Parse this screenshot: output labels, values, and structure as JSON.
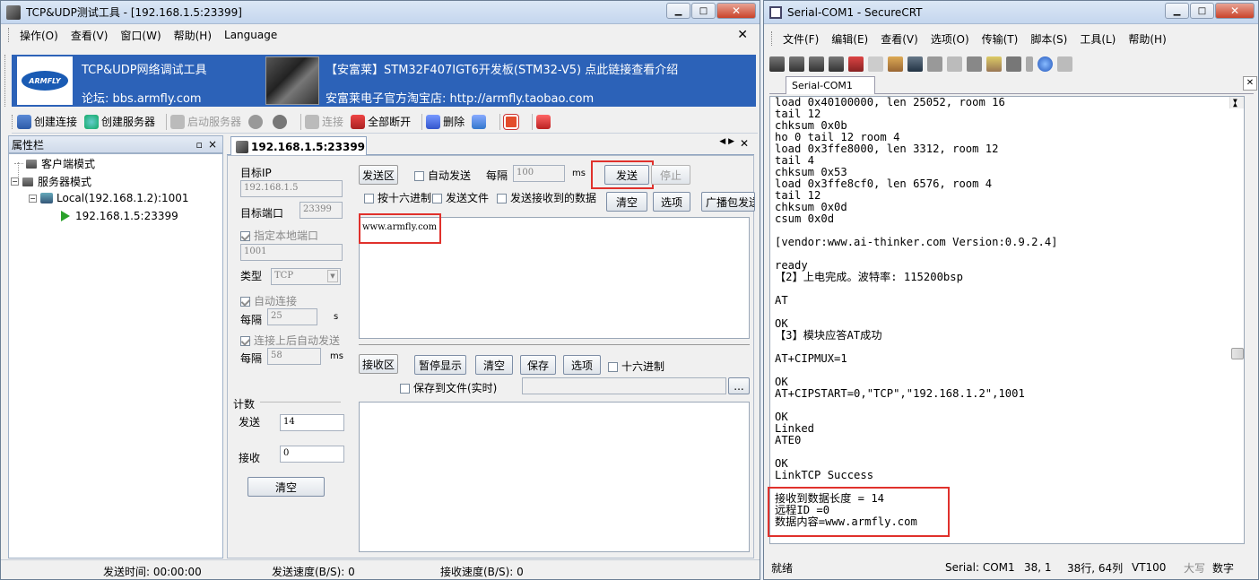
{
  "left_window": {
    "title": "TCP&UDP测试工具 - [192.168.1.5:23399]",
    "menu": [
      "操作(O)",
      "查看(V)",
      "窗口(W)",
      "帮助(H)",
      "Language"
    ],
    "banner": {
      "logo_text": "ARMFLY",
      "line1_left": "TCP&UDP网络调试工具",
      "line2_left": "论坛: bbs.armfly.com",
      "line1_right": "【安富莱】STM32F407IGT6开发板(STM32-V5) 点此链接查看介绍",
      "line2_right": "安富莱电子官方淘宝店: http://armfly.taobao.com"
    },
    "toolbar": [
      "创建连接",
      "创建服务器",
      "启动服务器",
      "连接",
      "全部断开",
      "删除"
    ],
    "sidebar": {
      "title": "属性栏",
      "pin": "ᵖ",
      "close": "×",
      "items": [
        "客户端模式",
        "服务器模式",
        "Local(192.168.1.2):1001",
        "192.168.1.5:23399"
      ]
    },
    "tab": {
      "label": "192.168.1.5:23399"
    },
    "settings": {
      "target_ip_label": "目标IP",
      "target_ip": "192.168.1.5",
      "target_port_label": "目标端口",
      "target_port": "23399",
      "local_port_label": "指定本地端口",
      "local_port": "1001",
      "type_label": "类型",
      "type_value": "TCP",
      "auto_connect_label": "自动连接",
      "interval_label": "每隔",
      "interval1": "25",
      "interval1_unit": "s",
      "auto_send_after_label": "连接上后自动发送",
      "interval2": "58",
      "interval2_unit": "ms",
      "count_label": "计数",
      "send_label": "发送",
      "send_count": "14",
      "recv_label": "接收",
      "recv_count": "0",
      "clear_label": "清空"
    },
    "send": {
      "area_label": "发送区",
      "auto_send": "自动发送",
      "interval_label": "每隔",
      "interval_value": "100",
      "interval_unit": "ms",
      "send_button": "发送",
      "stop_button": "停止",
      "hex_label": "按十六进制",
      "file_label": "发送文件",
      "send_received_label": "发送接收到的数据",
      "clear_button": "清空",
      "options_button": "选项",
      "broadcast_button": "广播包发送",
      "content": "www.armfly.com"
    },
    "receive": {
      "area_label": "接收区",
      "pause_button": "暂停显示",
      "clear_button": "清空",
      "save_button": "保存",
      "options_button": "选项",
      "hex_label": "十六进制",
      "save_file_label": "保存到文件(实时)",
      "browse": "..."
    },
    "status": {
      "send_time": "发送时间: 00:00:00",
      "send_speed": "发送速度(B/S): 0",
      "recv_speed": "接收速度(B/S): 0"
    }
  },
  "right_window": {
    "title": "Serial-COM1 - SecureCRT",
    "menu": [
      "文件(F)",
      "编辑(E)",
      "查看(V)",
      "选项(O)",
      "传输(T)",
      "脚本(S)",
      "工具(L)",
      "帮助(H)"
    ],
    "tab_label": "Serial-COM1",
    "terminal_lines": [
      "load 0x40100000, len 25052, room 16",
      "tail 12",
      "chksum 0x0b",
      "ho 0 tail 12 room 4",
      "load 0x3ffe8000, len 3312, room 12",
      "tail 4",
      "chksum 0x53",
      "load 0x3ffe8cf0, len 6576, room 4",
      "tail 12",
      "chksum 0x0d",
      "csum 0x0d",
      "",
      "[vendor:www.ai-thinker.com Version:0.9.2.4]",
      "",
      "ready",
      "【2】上电完成。波特率: 115200bsp",
      "",
      "AT",
      "",
      "OK",
      "【3】模块应答AT成功",
      "",
      "AT+CIPMUX=1",
      "",
      "OK",
      "AT+CIPSTART=0,\"TCP\",\"192.168.1.2\",1001",
      "",
      "OK",
      "Linked",
      "ATE0",
      "",
      "OK",
      "LinkTCP Success",
      "",
      "接收到数据长度 = 14",
      "远程ID =0",
      "数据内容=www.armfly.com"
    ],
    "status": {
      "ready": "就绪",
      "port": "Serial: COM1",
      "pos": "38,  1",
      "size": "38行, 64列",
      "term": "VT100",
      "caps": "大写",
      "num": "数字"
    }
  }
}
